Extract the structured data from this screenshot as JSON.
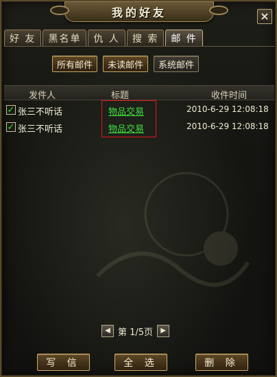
{
  "window": {
    "title": "我的好友",
    "close_label": "×"
  },
  "tabs": [
    "好 友",
    "黑名单",
    "仇 人",
    "搜 索",
    "邮 件"
  ],
  "filters": [
    "所有邮件",
    "未读邮件",
    "系统邮件"
  ],
  "table": {
    "headers": {
      "sender": "发件人",
      "subject": "标题",
      "time": "收件时间"
    },
    "rows": [
      {
        "checked": "✓",
        "sender": "张三不听话",
        "subject": "物品交易",
        "time": "2010-6-29 12:08:18"
      },
      {
        "checked": "✓",
        "sender": "张三不听话",
        "subject": "物品交易",
        "time": "2010-6-29 12:08:18"
      }
    ]
  },
  "pager": {
    "prev": "◀",
    "text": "第 1/5页",
    "next": "▶"
  },
  "buttons": {
    "write": "写 信",
    "select_all": "全 选",
    "delete": "删 除"
  },
  "colors": {
    "link_green": "#3fe03f",
    "highlight_red": "#e01818",
    "gold_border": "#c9a764"
  }
}
